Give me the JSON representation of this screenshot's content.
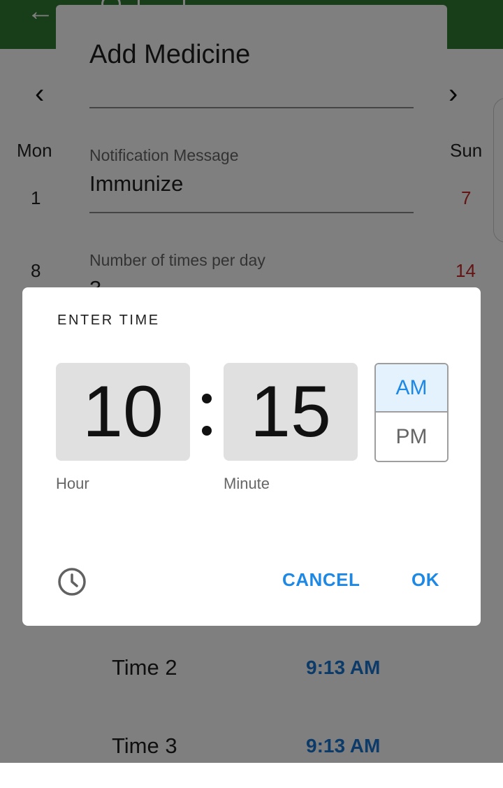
{
  "calendar": {
    "weekday_mon": "Mon",
    "weekday_sun": "Sun",
    "mon_days": [
      "1",
      "8"
    ],
    "sun_days": [
      "7",
      "14"
    ],
    "sun_color": "#c62828"
  },
  "med_dialog": {
    "title": "Add Medicine",
    "notification_label": "Notification Message",
    "notification_value": "Immunize",
    "times_label": "Number of times per day",
    "times_value": "3",
    "time_rows": [
      {
        "label": "Time 2",
        "value": "9:13 AM"
      },
      {
        "label": "Time 3",
        "value": "9:13 AM"
      }
    ]
  },
  "time_picker": {
    "header": "ENTER TIME",
    "hour": "10",
    "minute": "15",
    "separator": ":",
    "am_label": "AM",
    "pm_label": "PM",
    "selected_period": "AM",
    "hour_caption": "Hour",
    "minute_caption": "Minute",
    "cancel_label": "CANCEL",
    "ok_label": "OK",
    "mode_icon": "clock-icon"
  },
  "colors": {
    "appbar": "#2e7d32",
    "accent": "#1e88e5",
    "time_value": "#1976d2"
  }
}
